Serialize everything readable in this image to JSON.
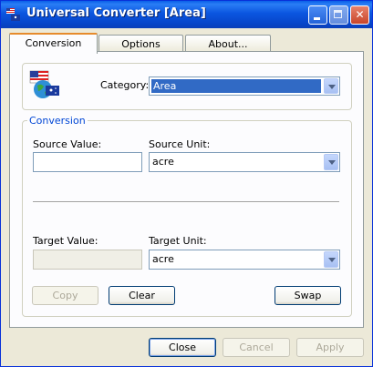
{
  "window": {
    "title": "Universal Converter [Area]",
    "app_icon": "flags-globe-icon"
  },
  "tabs": [
    {
      "label": "Conversion",
      "active": true
    },
    {
      "label": "Options",
      "active": false
    },
    {
      "label": "About...",
      "active": false
    }
  ],
  "category": {
    "label": "Category:",
    "value": "Area",
    "icon": "flags-globe-icon"
  },
  "conversion_group": {
    "title": "Conversion",
    "source_value_label": "Source Value:",
    "source_value": "",
    "source_unit_label": "Source Unit:",
    "source_unit": "acre",
    "target_value_label": "Target Value:",
    "target_value": "",
    "target_unit_label": "Target Unit:",
    "target_unit": "acre",
    "copy_label": "Copy",
    "clear_label": "Clear",
    "swap_label": "Swap"
  },
  "footer": {
    "close_label": "Close",
    "cancel_label": "Cancel",
    "apply_label": "Apply"
  },
  "colors": {
    "titlebar": "#0a56e0",
    "accent_tab": "#e68b2c",
    "group_title": "#0046d5",
    "selection": "#316ac5"
  }
}
